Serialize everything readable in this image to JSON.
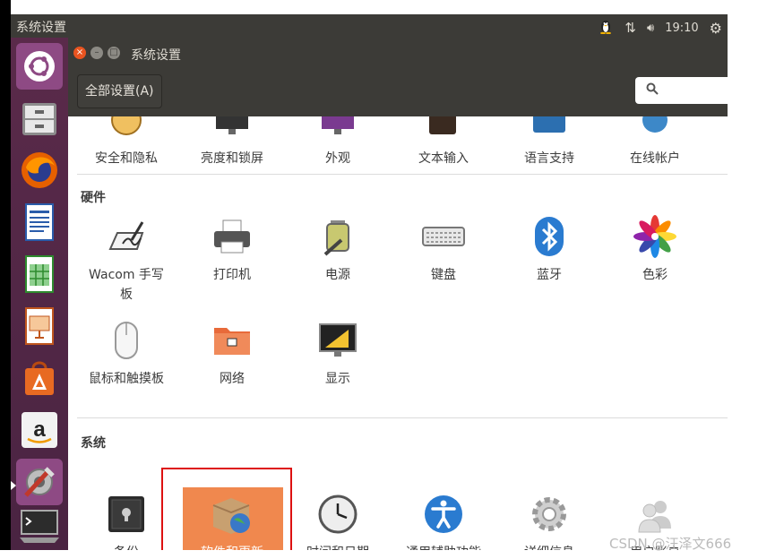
{
  "topbar": {
    "title": "系统设置",
    "time": "19:10"
  },
  "window": {
    "title": "系统设置",
    "all_settings": "全部设置(A)"
  },
  "partial_row": [
    "安全和隐私",
    "亮度和锁屏",
    "外观",
    "文本输入",
    "语言支持",
    "在线帐户"
  ],
  "hardware": {
    "title": "硬件",
    "row1": [
      "Wacom 手写",
      "打印机",
      "电源",
      "键盘",
      "蓝牙",
      "色彩"
    ],
    "wacom_line2": "板",
    "row2": [
      "鼠标和触摸板",
      "网络",
      "显示"
    ]
  },
  "system": {
    "title": "系统",
    "items": [
      "备份",
      "软件和更新",
      "时间和日期",
      "通用辅助功能",
      "详细信息",
      "用户账户"
    ]
  },
  "watermark": "CSDN @汪泽文666"
}
